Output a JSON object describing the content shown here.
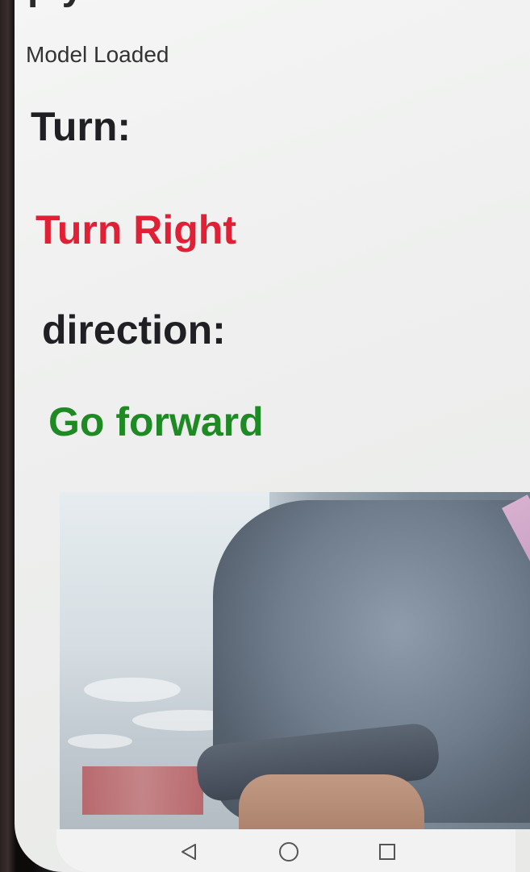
{
  "app": {
    "header_partial": "p y",
    "status": "Model Loaded"
  },
  "turn": {
    "label": "Turn:",
    "value": "Turn Right",
    "value_color": "#e11f35"
  },
  "direction": {
    "label": "direction:",
    "value": "Go forward",
    "value_color": "#1e8a24"
  },
  "navigation": {
    "back_icon": "back-triangle-icon",
    "home_icon": "home-circle-icon",
    "recent_icon": "recent-square-icon"
  }
}
